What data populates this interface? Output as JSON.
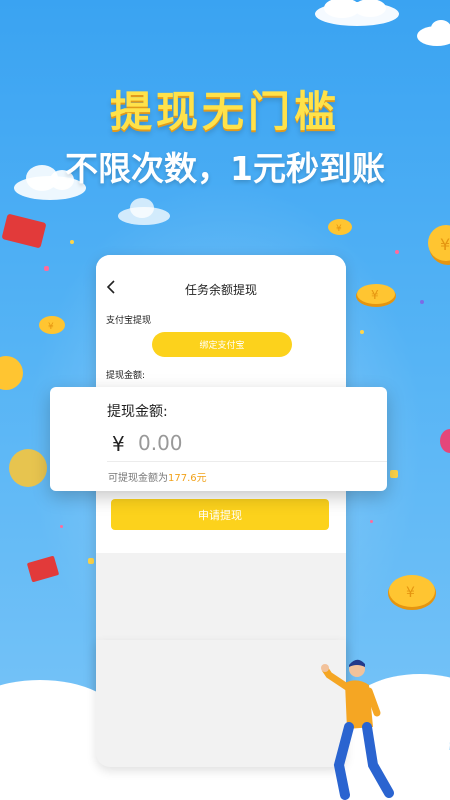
{
  "banner": {
    "headline": "提现无门槛",
    "subheadline": "不限次数，1元秒到账"
  },
  "screen": {
    "title": "任务余额提现",
    "alipay_section_label": "支付宝提现",
    "bind_alipay_button": "绑定支付宝",
    "amount_label": "提现金额:",
    "apply_button": "申请提现"
  },
  "popup": {
    "amount_label": "提现金额:",
    "currency_symbol": "¥",
    "amount_placeholder": "0.00",
    "available_prefix": "可提现金额为",
    "available_amount": "177.6元"
  },
  "colors": {
    "background_top": "#3aa3f2",
    "accent_yellow": "#fcd21c",
    "highlight_orange": "#f1a21b"
  }
}
